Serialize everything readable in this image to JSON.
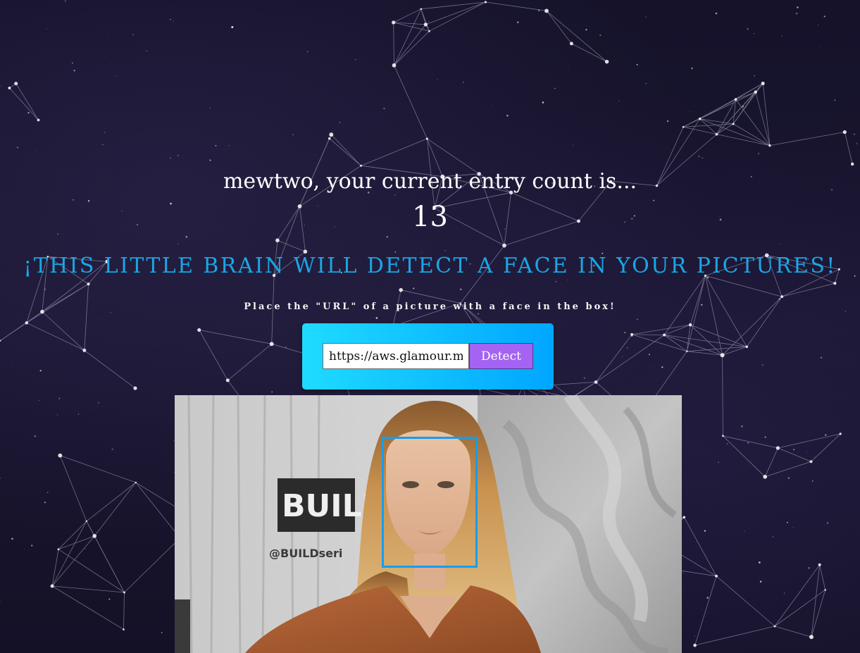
{
  "rank": {
    "greeting": "mewtwo, your current entry count is...",
    "count": "13"
  },
  "headline": "¡THIS LITTLE BRAIN WILL DETECT A FACE IN YOUR PICTURES!",
  "instructions": "Place the \"URL\" of a picture with a face in the box!",
  "form": {
    "url_value": "https://aws.glamour.mx",
    "detect_label": "Detect"
  },
  "photo": {
    "sign_text": "BUILD",
    "handle_text": "@BUILDseri"
  },
  "colors": {
    "headline": "#1aa6e6",
    "card_gradient_start": "#1fdbff",
    "card_gradient_end": "#00a6ff",
    "button": "#a463f2",
    "face_box": "#149df2"
  }
}
